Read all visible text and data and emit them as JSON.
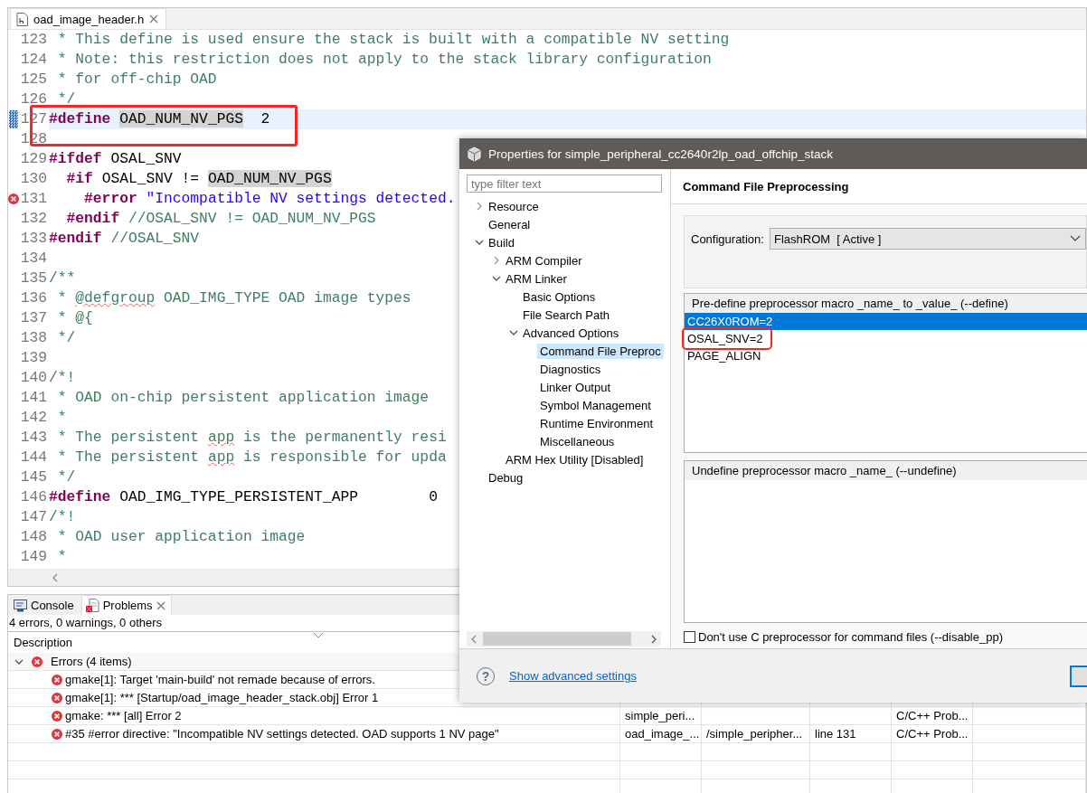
{
  "editor": {
    "tab": {
      "label": "oad_image_header.h",
      "selected": true
    },
    "lines": [
      {
        "number": "123",
        "current": false,
        "error": false,
        "annotated": false,
        "segments": [
          {
            "kind": "comment",
            "text": " * This define is used ensure the stack is built with a compatible NV setting"
          }
        ]
      },
      {
        "number": "124",
        "current": false,
        "error": false,
        "annotated": false,
        "segments": [
          {
            "kind": "comment",
            "text": " * Note: this restriction does not apply to the stack library configuration"
          }
        ]
      },
      {
        "number": "125",
        "current": false,
        "error": false,
        "annotated": false,
        "segments": [
          {
            "kind": "comment",
            "text": " * for off-chip OAD"
          }
        ]
      },
      {
        "number": "126",
        "current": false,
        "error": false,
        "annotated": false,
        "segments": [
          {
            "kind": "comment",
            "text": " */"
          }
        ]
      },
      {
        "number": "127",
        "current": true,
        "error": false,
        "annotated": true,
        "segments": [
          {
            "kind": "keyword",
            "text": "#define "
          },
          {
            "kind": "occurrence",
            "text": "OAD_NUM_NV_PGS"
          },
          {
            "kind": "plain",
            "text": "  2"
          }
        ]
      },
      {
        "number": "128",
        "current": false,
        "error": false,
        "annotated": false
      },
      {
        "number": "129",
        "current": false,
        "error": false,
        "annotated": false,
        "segments": [
          {
            "kind": "keyword",
            "text": "#ifdef"
          },
          {
            "kind": "plain",
            "text": " OSAL_SNV"
          }
        ]
      },
      {
        "number": "130",
        "current": false,
        "error": false,
        "annotated": false,
        "segments": [
          {
            "kind": "keyword",
            "text": "  #if"
          },
          {
            "kind": "plain",
            "text": " OSAL_SNV != "
          },
          {
            "kind": "occurrence",
            "text": "OAD_NUM_NV_PGS"
          }
        ]
      },
      {
        "number": "131",
        "current": false,
        "error": true,
        "annotated": false,
        "segments": [
          {
            "kind": "keyword",
            "text": "    #error "
          },
          {
            "kind": "string",
            "text": "\"Incompatible NV settings detected."
          }
        ]
      },
      {
        "number": "132",
        "current": false,
        "error": false,
        "annotated": false,
        "segments": [
          {
            "kind": "keyword",
            "text": "  #endif "
          },
          {
            "kind": "comment",
            "text": "//OSAL_SNV != OAD_NUM_NV_PGS"
          }
        ]
      },
      {
        "number": "133",
        "current": false,
        "error": false,
        "annotated": false,
        "segments": [
          {
            "kind": "keyword",
            "text": "#endif "
          },
          {
            "kind": "comment",
            "text": "//OSAL_SNV"
          }
        ]
      },
      {
        "number": "134",
        "current": false,
        "error": false,
        "annotated": false
      },
      {
        "number": "135",
        "current": false,
        "error": false,
        "annotated": false,
        "segments": [
          {
            "kind": "comment",
            "text": "/**"
          }
        ]
      },
      {
        "number": "136",
        "current": false,
        "error": false,
        "annotated": false,
        "segments": [
          {
            "kind": "comment",
            "text": " * "
          },
          {
            "kind": "flagged",
            "text": "@defgroup"
          },
          {
            "kind": "comment",
            "text": " OAD_IMG_TYPE OAD image types"
          }
        ]
      },
      {
        "number": "137",
        "current": false,
        "error": false,
        "annotated": false,
        "segments": [
          {
            "kind": "comment",
            "text": " * @{"
          }
        ]
      },
      {
        "number": "138",
        "current": false,
        "error": false,
        "annotated": false,
        "segments": [
          {
            "kind": "comment",
            "text": " */"
          }
        ]
      },
      {
        "number": "139",
        "current": false,
        "error": false,
        "annotated": false
      },
      {
        "number": "140",
        "current": false,
        "error": false,
        "annotated": false,
        "segments": [
          {
            "kind": "comment",
            "text": "/*!"
          }
        ]
      },
      {
        "number": "141",
        "current": false,
        "error": false,
        "annotated": false,
        "segments": [
          {
            "kind": "comment",
            "text": " * OAD on-chip persistent application image"
          }
        ]
      },
      {
        "number": "142",
        "current": false,
        "error": false,
        "annotated": false,
        "segments": [
          {
            "kind": "comment",
            "text": " *"
          }
        ]
      },
      {
        "number": "143",
        "current": false,
        "error": false,
        "annotated": false,
        "segments": [
          {
            "kind": "comment",
            "text": " * The persistent "
          },
          {
            "kind": "flagged",
            "text": "app"
          },
          {
            "kind": "comment",
            "text": " is the permanently resi"
          }
        ]
      },
      {
        "number": "144",
        "current": false,
        "error": false,
        "annotated": false,
        "segments": [
          {
            "kind": "comment",
            "text": " * The persistent "
          },
          {
            "kind": "flagged",
            "text": "app"
          },
          {
            "kind": "comment",
            "text": " is responsible for upda"
          }
        ]
      },
      {
        "number": "145",
        "current": false,
        "error": false,
        "annotated": false,
        "segments": [
          {
            "kind": "comment",
            "text": " */"
          }
        ]
      },
      {
        "number": "146",
        "current": false,
        "error": false,
        "annotated": false,
        "segments": [
          {
            "kind": "keyword",
            "text": "#define"
          },
          {
            "kind": "plain",
            "text": " OAD_IMG_TYPE_PERSISTENT_APP        0"
          }
        ]
      },
      {
        "number": "147",
        "current": false,
        "error": false,
        "annotated": false,
        "segments": [
          {
            "kind": "comment",
            "text": "/*!"
          }
        ]
      },
      {
        "number": "148",
        "current": false,
        "error": false,
        "annotated": false,
        "segments": [
          {
            "kind": "comment",
            "text": " * OAD user application image"
          }
        ]
      },
      {
        "number": "149",
        "current": false,
        "error": false,
        "annotated": false,
        "segments": [
          {
            "kind": "comment",
            "text": " *"
          }
        ]
      }
    ]
  },
  "dialog": {
    "title": "Properties for simple_peripheral_cc2640r2lp_oad_offchip_stack",
    "filter": {
      "placeholder": "type filter text"
    },
    "tree": [
      {
        "label": "Resource",
        "selected": false,
        "expanded": false
      },
      {
        "label": "General",
        "selected": false
      },
      {
        "label": "Build",
        "selected": false,
        "expanded": true,
        "children": [
          {
            "label": "ARM Compiler",
            "selected": false,
            "expanded": false
          },
          {
            "label": "ARM Linker",
            "selected": false,
            "expanded": true,
            "children": [
              {
                "label": "Basic Options",
                "selected": false
              },
              {
                "label": "File Search Path",
                "selected": false
              },
              {
                "label": "Advanced Options",
                "selected": false,
                "expanded": true,
                "children": [
                  {
                    "label": "Command File Preproc",
                    "selected": true
                  },
                  {
                    "label": "Diagnostics",
                    "selected": false
                  },
                  {
                    "label": "Linker Output",
                    "selected": false
                  },
                  {
                    "label": "Symbol Management",
                    "selected": false
                  },
                  {
                    "label": "Runtime Environment",
                    "selected": false
                  },
                  {
                    "label": "Miscellaneous",
                    "selected": false
                  }
                ]
              }
            ]
          },
          {
            "label": "ARM Hex Utility  [Disabled]",
            "selected": false
          }
        ]
      },
      {
        "label": "Debug",
        "selected": false
      }
    ],
    "heading": "Command File Preprocessing",
    "configuration": {
      "label": "Configuration:",
      "value": "FlashROM  [ Active ]"
    },
    "define_list": {
      "header": "Pre-define preprocessor macro _name_ to _value_ (--define)",
      "items": [
        {
          "text": "CC26X0ROM=2",
          "selected": true,
          "annotated": false
        },
        {
          "text": "OSAL_SNV=2",
          "selected": false,
          "annotated": true
        },
        {
          "text": "PAGE_ALIGN",
          "selected": false,
          "annotated": false
        }
      ]
    },
    "undefine_list": {
      "header": "Undefine preprocessor macro _name_ (--undefine)"
    },
    "disable_pp": {
      "label": "Don't use C preprocessor for command files (--disable_pp)",
      "checked": false
    },
    "help": "?",
    "advanced_link": "Show advanced settings"
  },
  "problems": {
    "tabs": [
      {
        "label": "Console",
        "kind": "console",
        "selected": false
      },
      {
        "label": "Problems",
        "kind": "problems",
        "selected": true
      }
    ],
    "summary": "4 errors, 0 warnings, 0 others",
    "columns": [
      "Description"
    ],
    "groups": [
      {
        "label": "Errors (4 items)",
        "expanded": true,
        "children": [
          {
            "description": "gmake[1]: Target 'main-build' not remade because of errors."
          },
          {
            "description": "gmake[1]: *** [Startup/oad_image_header_stack.obj] Error 1"
          },
          {
            "description": "gmake: *** [all] Error 2",
            "resource": "simple_peri...",
            "type": "C/C++ Prob..."
          },
          {
            "description": "#35 #error directive: \"Incompatible NV settings detected. OAD supports 1 NV page\"",
            "resource": "oad_image_...",
            "path": "/simple_peripher...",
            "location": "line 131",
            "type": "C/C++ Prob..."
          }
        ]
      }
    ]
  }
}
